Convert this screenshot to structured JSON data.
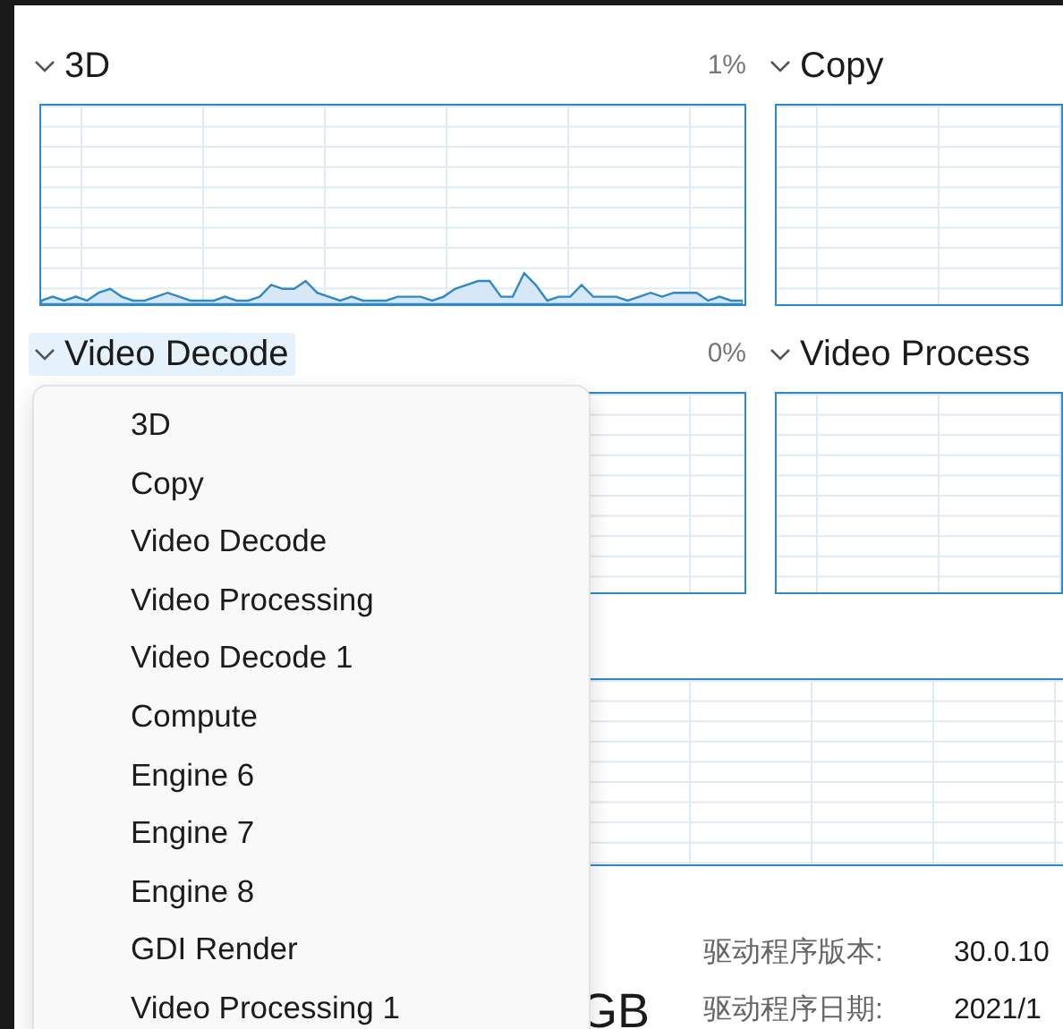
{
  "engines": [
    {
      "title": "3D",
      "percent": "1%",
      "selected": false
    },
    {
      "title": "Copy",
      "selected": false
    },
    {
      "title": "Video Decode",
      "percent": "0%",
      "selected": true
    },
    {
      "title": "Video Process",
      "selected": false
    }
  ],
  "dropdown": {
    "items": [
      "3D",
      "Copy",
      "Video Decode",
      "Video Processing",
      "Video Decode 1",
      "Compute",
      "Engine 6",
      "Engine 7",
      "Engine 8",
      "GDI Render",
      "Video Processing 1"
    ]
  },
  "memory_value": "GB",
  "details": [
    {
      "label": "驱动程序版本:",
      "value": "30.0.10"
    },
    {
      "label": "驱动程序日期:",
      "value": "2021/1"
    }
  ]
}
